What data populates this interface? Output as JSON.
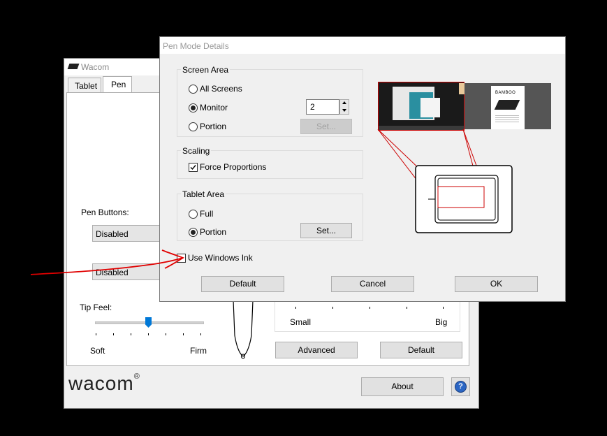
{
  "wacom": {
    "title": "Wacom",
    "tabs": [
      "Tablet",
      "Pen"
    ],
    "pen_buttons_label": "Pen Buttons:",
    "button1_value": "Disabled",
    "button2_value": "Disabled",
    "tip_feel_label": "Tip Feel:",
    "soft_label": "Soft",
    "firm_label": "Firm",
    "small_label": "Small",
    "big_label": "Big",
    "advanced_label": "Advanced",
    "default_label": "Default",
    "about_label": "About",
    "help_label": "?",
    "logo_text": "wacom",
    "logo_reg": "®",
    "tip_feel_level": 0.5
  },
  "dialog": {
    "title": "Pen Mode Details",
    "screen_area": {
      "label": "Screen Area",
      "options": [
        "All Screens",
        "Monitor",
        "Portion"
      ],
      "selected": "Monitor",
      "monitor_value": "2",
      "set_label": "Set..."
    },
    "scaling": {
      "label": "Scaling",
      "force_proportions": "Force Proportions",
      "force_checked": true
    },
    "tablet_area": {
      "label": "Tablet Area",
      "options": [
        "Full",
        "Portion"
      ],
      "selected": "Portion",
      "set_label": "Set..."
    },
    "use_windows_ink": "Use Windows Ink",
    "use_windows_ink_checked": false,
    "buttons": {
      "default": "Default",
      "cancel": "Cancel",
      "ok": "OK"
    },
    "preview": {
      "screen2_label": "BAMBOO"
    }
  },
  "colors": {
    "annotation": "#e00000",
    "accent": "#0078d7",
    "help": "#2b66c4"
  }
}
